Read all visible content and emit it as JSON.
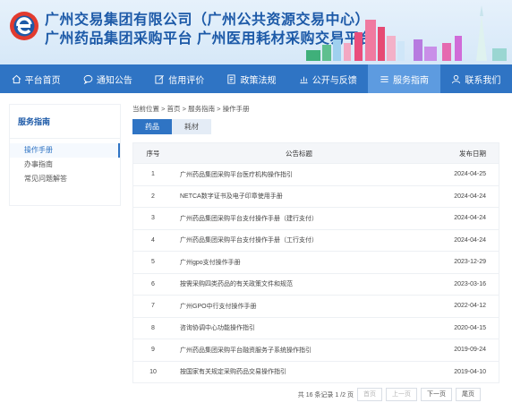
{
  "header": {
    "title_line1": "广州交易集团有限公司（广州公共资源交易中心）",
    "title_line2": "广州药品集团采购平台  广州医用耗材采购交易平台",
    "logo_icon": "e-logo-icon"
  },
  "nav": {
    "items": [
      {
        "label": "平台首页",
        "icon": "home-icon"
      },
      {
        "label": "通知公告",
        "icon": "chat-icon"
      },
      {
        "label": "信用评价",
        "icon": "edit-icon"
      },
      {
        "label": "政策法规",
        "icon": "document-icon"
      },
      {
        "label": "公开与反馈",
        "icon": "chart-icon"
      },
      {
        "label": "服务指南",
        "icon": "list-icon",
        "active": true
      },
      {
        "label": "联系我们",
        "icon": "user-icon"
      }
    ],
    "colors": {
      "bar": "#2f74c4",
      "active": "#5d9be0"
    }
  },
  "sidebar": {
    "title": "服务指南",
    "items": [
      {
        "label": "操作手册",
        "active": true
      },
      {
        "label": "办事指南"
      },
      {
        "label": "常见问题解答"
      }
    ]
  },
  "breadcrumb": "当前位置 > 首页 > 服务指南 > 操作手册",
  "tabs": [
    {
      "label": "药品",
      "active": true
    },
    {
      "label": "耗材",
      "active": false
    }
  ],
  "table": {
    "headers": [
      "序号",
      "公告标题",
      "发布日期"
    ],
    "rows": [
      {
        "num": "1",
        "title": "广州药品集团采购平台医疗机构操作指引",
        "date": "2024-04-25"
      },
      {
        "num": "2",
        "title": "NETCA数字证书及电子印章使用手册",
        "date": "2024-04-24"
      },
      {
        "num": "3",
        "title": "广州药品集团采购平台支付操作手册（建行支付）",
        "date": "2024-04-24"
      },
      {
        "num": "4",
        "title": "广州药品集团采购平台支付操作手册（工行支付）",
        "date": "2024-04-24"
      },
      {
        "num": "5",
        "title": "广州gpo支付操作手册",
        "date": "2023-12-29"
      },
      {
        "num": "6",
        "title": "按需采购四类药品的有关政策文件和规范",
        "date": "2023-03-16"
      },
      {
        "num": "7",
        "title": "广州GPO中行支付操作手册",
        "date": "2022-04-12"
      },
      {
        "num": "8",
        "title": "咨询协调中心功能操作指引",
        "date": "2020-04-15"
      },
      {
        "num": "9",
        "title": "广州药品集团采购平台融资服务子系统操作指引",
        "date": "2019-09-24"
      },
      {
        "num": "10",
        "title": "按国家有关规定采购药品交易操作指引",
        "date": "2019-04-10"
      }
    ]
  },
  "pager": {
    "summary": "共 16 条记录 1 /2 页",
    "first": "首页",
    "prev": "上一页",
    "next": "下一页",
    "last": "尾页"
  }
}
